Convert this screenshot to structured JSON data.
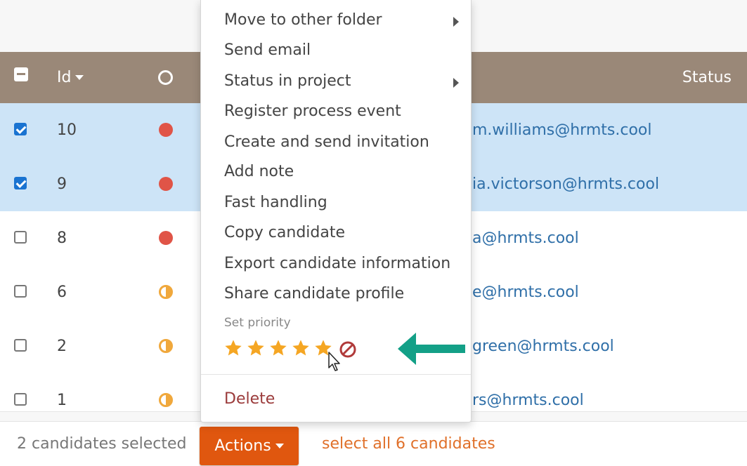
{
  "table": {
    "header": {
      "id_label": "Id",
      "status_label": "Status"
    },
    "rows": [
      {
        "id": "10",
        "email": "m.williams@hrmts.cool",
        "selected": true,
        "dot": "red"
      },
      {
        "id": "9",
        "email": "ia.victorson@hrmts.cool",
        "selected": true,
        "dot": "red"
      },
      {
        "id": "8",
        "email": "a@hrmts.cool",
        "selected": false,
        "dot": "red"
      },
      {
        "id": "6",
        "email": "e@hrmts.cool",
        "selected": false,
        "dot": "half"
      },
      {
        "id": "2",
        "email": "green@hrmts.cool",
        "selected": false,
        "dot": "half"
      },
      {
        "id": "1",
        "email": "rs@hrmts.cool",
        "selected": false,
        "dot": "half"
      }
    ]
  },
  "menu": {
    "items": [
      "Move to other folder",
      "Send email",
      "Status in project",
      "Register process event",
      "Create and send invitation",
      "Add note",
      "Fast handling",
      "Copy candidate",
      "Export candidate information",
      "Share candidate profile"
    ],
    "priority_label": "Set priority",
    "priority_stars": 5,
    "delete_label": "Delete"
  },
  "footer": {
    "selected_text": "2 candidates selected",
    "actions_label": "Actions",
    "select_all_text": "select all 6 candidates"
  },
  "colors": {
    "header_bg": "#9a8878",
    "selected_row": "#cde4f7",
    "accent_orange": "#e0570f",
    "link_blue": "#2f6fa8",
    "star": "#f5a623",
    "annotation_arrow": "#13a087"
  }
}
